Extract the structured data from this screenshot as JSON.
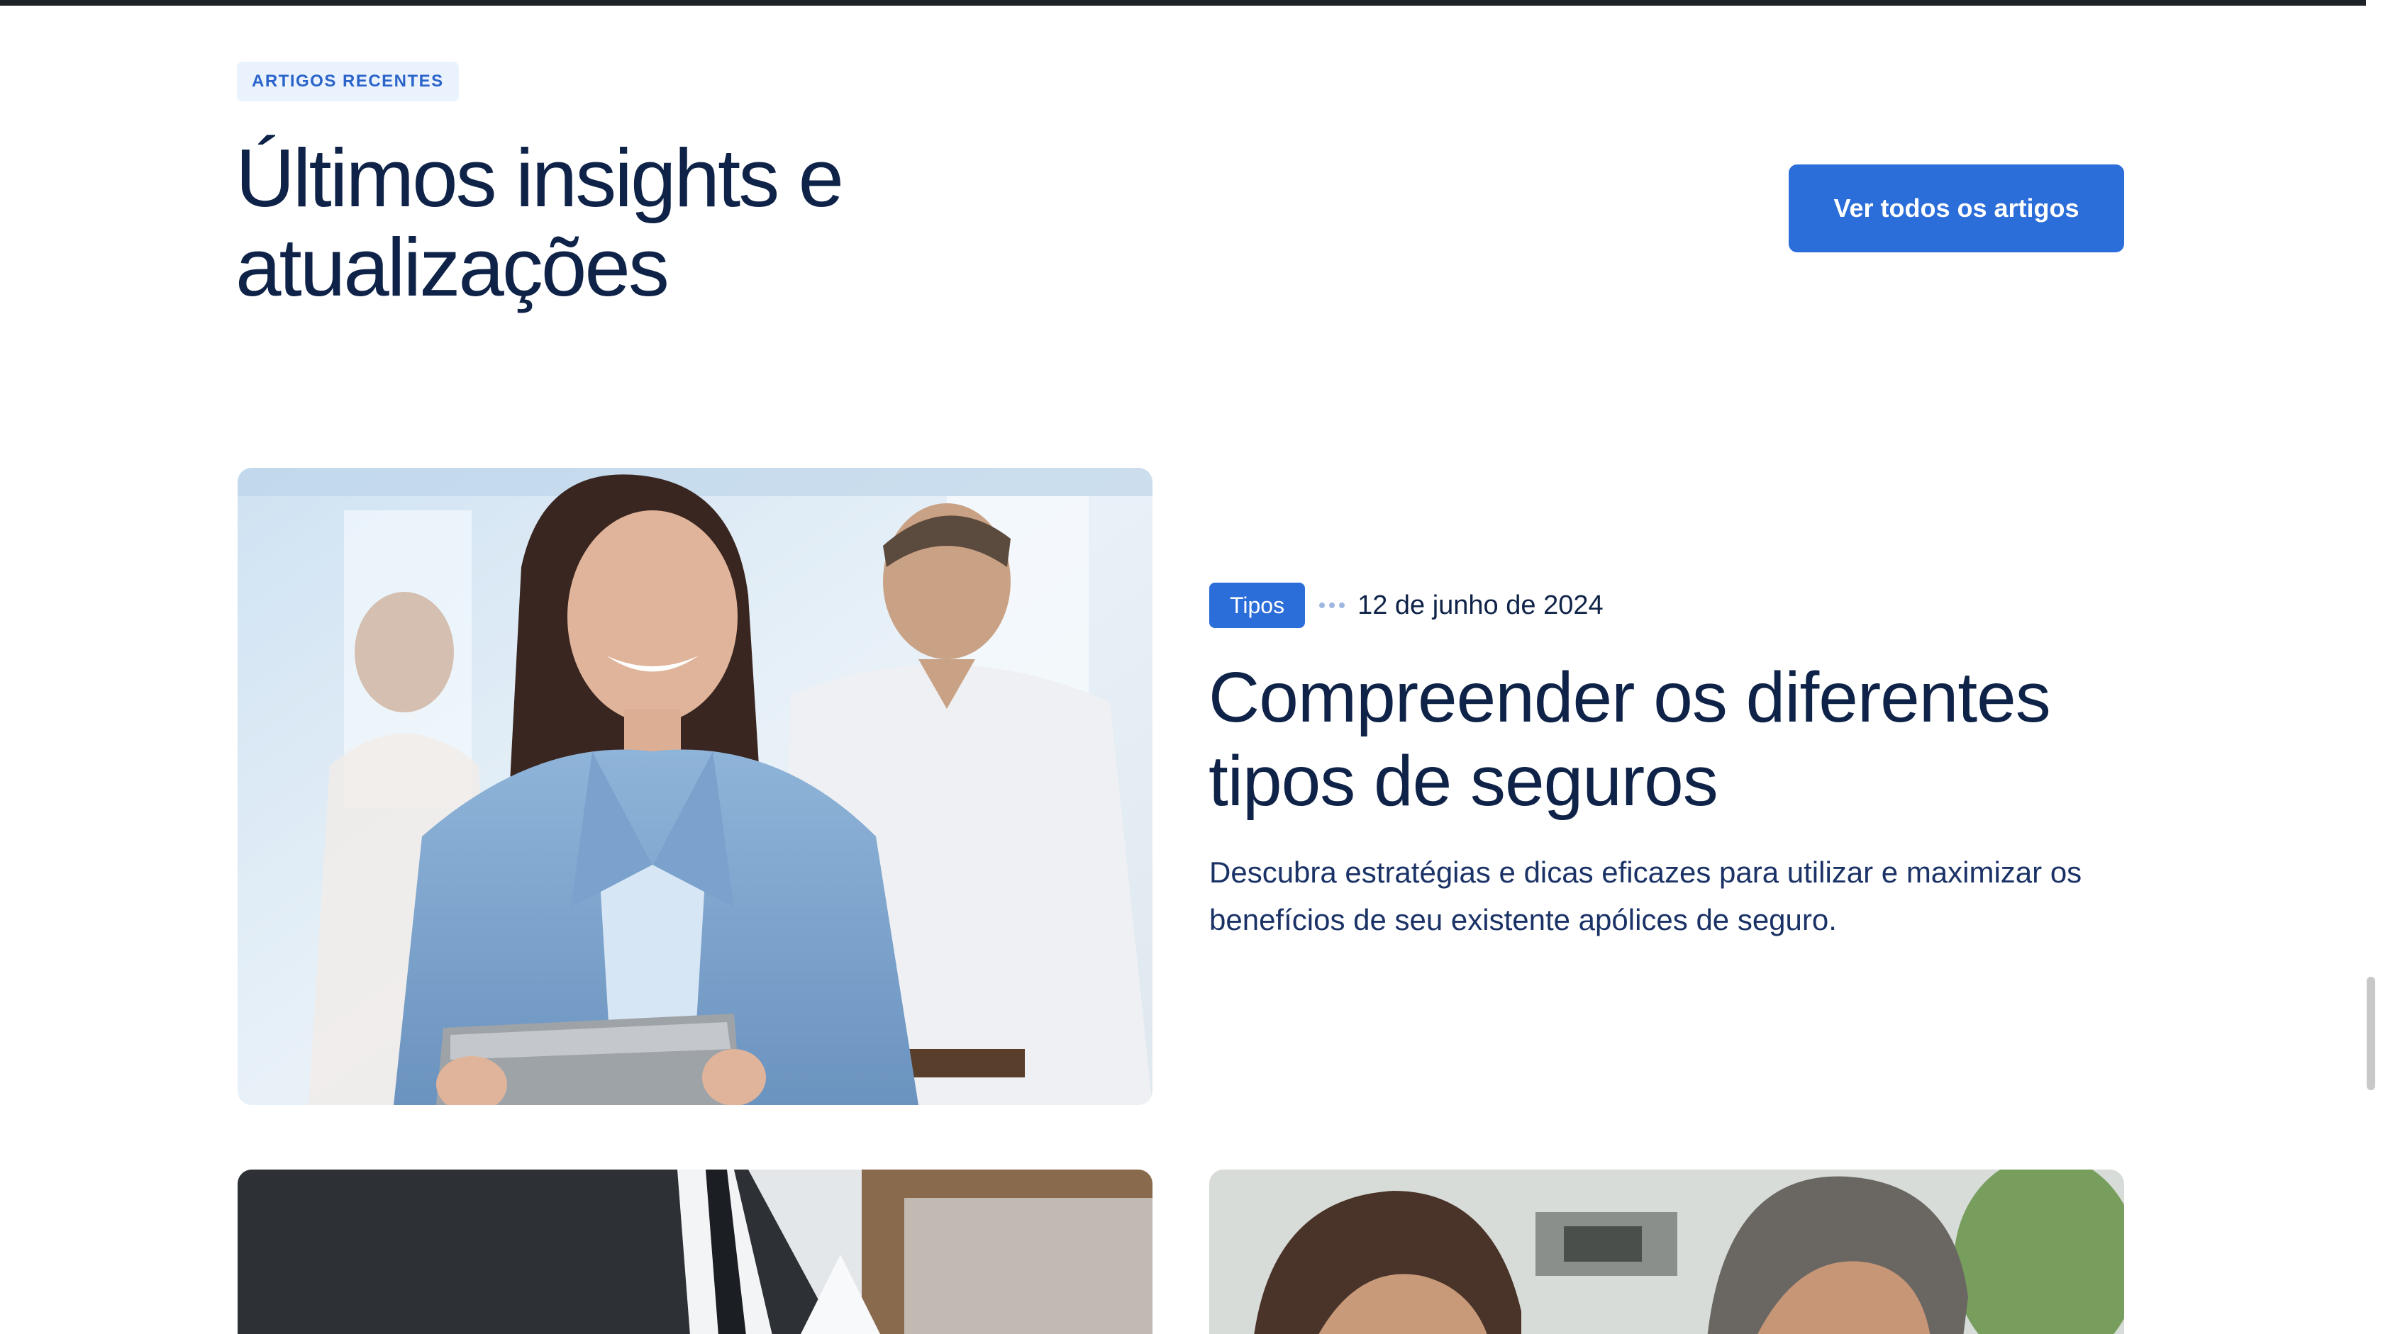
{
  "section": {
    "badge": "ARTIGOS RECENTES",
    "title": "Últimos insights e atualizações",
    "view_all_label": "Ver todos os artigos"
  },
  "featured_post": {
    "category": "Tipos",
    "date": "12 de junho de 2024",
    "title": "Compreender os diferentes tipos de seguros",
    "excerpt": "Descubra estratégias e dicas eficazes para utilizar e maximizar os benefícios de seu existente apólices de seguro."
  },
  "colors": {
    "accent": "#2b6dd9",
    "heading": "#0f2348",
    "badge_background": "#eaf2fd"
  }
}
